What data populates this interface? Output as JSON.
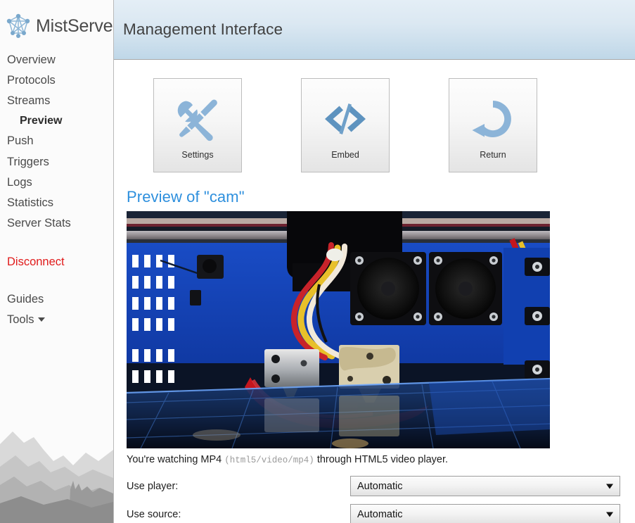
{
  "brand": {
    "name": "MistServer",
    "logo_icon": "network-node-graph-icon"
  },
  "header": {
    "title": "Management Interface"
  },
  "sidebar": {
    "items": [
      {
        "label": "Overview",
        "active": false,
        "sub": false,
        "danger": false
      },
      {
        "label": "Protocols",
        "active": false,
        "sub": false,
        "danger": false
      },
      {
        "label": "Streams",
        "active": false,
        "sub": false,
        "danger": false
      },
      {
        "label": "Preview",
        "active": true,
        "sub": true,
        "danger": false
      },
      {
        "label": "Push",
        "active": false,
        "sub": false,
        "danger": false
      },
      {
        "label": "Triggers",
        "active": false,
        "sub": false,
        "danger": false
      },
      {
        "label": "Logs",
        "active": false,
        "sub": false,
        "danger": false
      },
      {
        "label": "Statistics",
        "active": false,
        "sub": false,
        "danger": false
      },
      {
        "label": "Server Stats",
        "active": false,
        "sub": false,
        "danger": false
      }
    ],
    "disconnect_label": "Disconnect",
    "disconnect_color": "#e01b1b",
    "guides_label": "Guides",
    "tools_label": "Tools",
    "tools_caret_icon": "chevron-down-icon",
    "watermark": "mountain-landscape-watermark"
  },
  "toolbar": {
    "buttons": [
      {
        "label": "Settings",
        "icon": "wrench-screwdriver-icon"
      },
      {
        "label": "Embed",
        "icon": "code-brackets-icon"
      },
      {
        "label": "Return",
        "icon": "circular-arrow-icon"
      }
    ],
    "icon_color": "#89b3d6"
  },
  "preview": {
    "heading": "Preview of \"cam\"",
    "heading_color": "#2d8fdd",
    "stream_name": "cam",
    "video_alt": "live camera view of a dual-extruder 3D printer printing on a reflective glass bed",
    "status": {
      "prefix": "You're watching MP4 ",
      "mime": "(html5/video/mp4)",
      "suffix": " through HTML5 video player."
    }
  },
  "form": {
    "rows": [
      {
        "label": "Use player:",
        "value": "Automatic",
        "arrow_icon": "chevron-down-icon"
      },
      {
        "label": "Use source:",
        "value": "Automatic",
        "arrow_icon": "chevron-down-icon"
      }
    ]
  }
}
